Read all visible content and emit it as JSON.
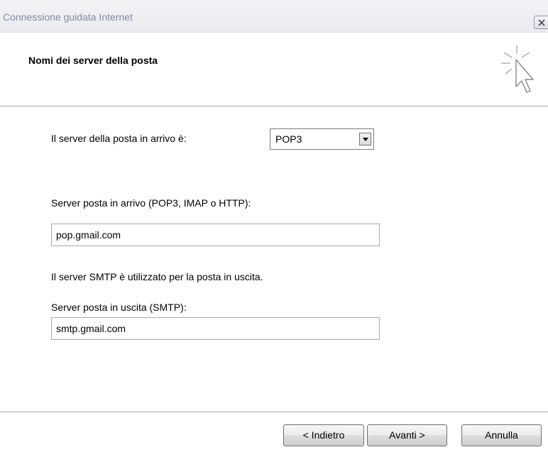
{
  "window": {
    "title": "Connessione guidata Internet",
    "close_icon": "close-icon"
  },
  "header": {
    "title": "Nomi dei server della posta",
    "icon": "wizard-cursor-icon"
  },
  "form": {
    "incoming_type_label": "Il server della posta in arrivo è:",
    "incoming_type_value": "POP3",
    "incoming_server_label": "Server posta in arrivo (POP3, IMAP o HTTP):",
    "incoming_server_value": "pop.gmail.com",
    "smtp_info": "Il server SMTP è utilizzato per la posta in uscita.",
    "outgoing_server_label": "Server posta in uscita (SMTP):",
    "outgoing_server_value": "smtp.gmail.com"
  },
  "footer": {
    "back_label": "< Indietro",
    "next_label": "Avanti >",
    "cancel_label": "Annulla"
  }
}
